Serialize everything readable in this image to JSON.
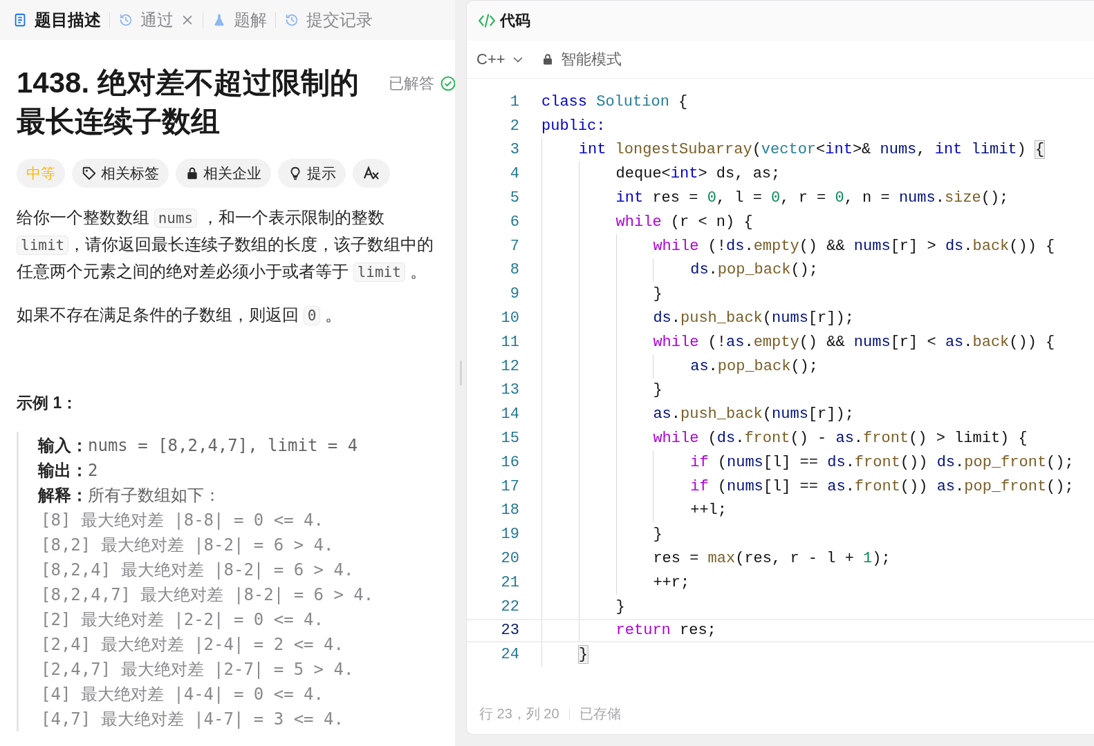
{
  "left_tabs": [
    {
      "label": "题目描述",
      "selected": true,
      "closable": false
    },
    {
      "label": "通过",
      "selected": false,
      "closable": true
    },
    {
      "label": "题解",
      "selected": false,
      "closable": false
    },
    {
      "label": "提交记录",
      "selected": false,
      "closable": false
    }
  ],
  "problem": {
    "title": "1438. 绝对差不超过限制的最长连续子数组",
    "status": "已解答",
    "tags": [
      {
        "kind": "difficulty",
        "label": "中等"
      },
      {
        "kind": "topics",
        "label": "相关标签"
      },
      {
        "kind": "companies",
        "label": "相关企业"
      },
      {
        "kind": "hint",
        "label": "提示"
      },
      {
        "kind": "translate"
      }
    ],
    "paragraphs": [
      [
        {
          "text": "给你一个整数数组 "
        },
        {
          "code": "nums"
        },
        {
          "text": " ，和一个表示限制的整数 "
        },
        {
          "code": "limit"
        },
        {
          "text": "，请你返回最长连续子数组的长度，该子数组中的任意两个元素之间的绝对差必须小于或者等于 "
        },
        {
          "code": "limit"
        },
        {
          "text": " 。"
        }
      ],
      [
        {
          "text": "如果不存在满足条件的子数组，则返回 "
        },
        {
          "code": "0"
        },
        {
          "text": " 。"
        }
      ]
    ],
    "example": {
      "heading": "示例 1：",
      "lines": [
        {
          "label": "输入：",
          "value": "nums = [8,2,4,7], limit = 4"
        },
        {
          "label": "输出：",
          "value": "2"
        },
        {
          "label": "解释：",
          "value": "所有子数组如下："
        },
        {
          "value": "[8] 最大绝对差 |8-8| = 0 <= 4."
        },
        {
          "value": "[8,2] 最大绝对差 |8-2| = 6 > 4."
        },
        {
          "value": "[8,2,4] 最大绝对差 |8-2| = 6 > 4."
        },
        {
          "value": "[8,2,4,7] 最大绝对差 |8-2| = 6 > 4."
        },
        {
          "value": "[2] 最大绝对差 |2-2| = 0 <= 4."
        },
        {
          "value": "[2,4] 最大绝对差 |2-4| = 2 <= 4."
        },
        {
          "value": "[2,4,7] 最大绝对差 |2-7| = 5 > 4."
        },
        {
          "value": "[4] 最大绝对差 |4-4| = 0 <= 4."
        },
        {
          "value": "[4,7] 最大绝对差 |4-7| = 3 <= 4."
        }
      ]
    }
  },
  "editor": {
    "title": "代码",
    "language": "C++",
    "mode": "智能模式",
    "lines": [
      {
        "number": "1",
        "current": false,
        "tokens": [
          {
            "kind": "keyword",
            "text": "class "
          },
          {
            "kind": "type",
            "text": "Solution"
          },
          {
            "kind": "plain",
            "text": " {"
          }
        ]
      },
      {
        "number": "2",
        "current": false,
        "tokens": [
          {
            "kind": "keyword",
            "text": "public:"
          }
        ]
      },
      {
        "number": "3",
        "current": false,
        "tokens": [
          {
            "kind": "indent"
          },
          {
            "kind": "keyword",
            "text": "int "
          },
          {
            "kind": "function",
            "text": "longestSubarray"
          },
          {
            "kind": "plain",
            "text": "("
          },
          {
            "kind": "type",
            "text": "vector"
          },
          {
            "kind": "plain",
            "text": "<"
          },
          {
            "kind": "keyword",
            "text": "int"
          },
          {
            "kind": "plain",
            "text": ">& "
          },
          {
            "kind": "variable",
            "text": "nums"
          },
          {
            "kind": "plain",
            "text": ", "
          },
          {
            "kind": "keyword",
            "text": "int "
          },
          {
            "kind": "variable",
            "text": "limit"
          },
          {
            "kind": "plain",
            "text": ") "
          },
          {
            "kind": "brace_match",
            "text": "{"
          }
        ]
      },
      {
        "number": "4",
        "current": false,
        "tokens": [
          {
            "kind": "indent"
          },
          {
            "kind": "indent"
          },
          {
            "kind": "plain",
            "text": "deque<"
          },
          {
            "kind": "keyword",
            "text": "int"
          },
          {
            "kind": "plain",
            "text": "> ds, as;"
          }
        ]
      },
      {
        "number": "5",
        "current": false,
        "tokens": [
          {
            "kind": "indent"
          },
          {
            "kind": "indent"
          },
          {
            "kind": "keyword",
            "text": "int "
          },
          {
            "kind": "plain",
            "text": "res = "
          },
          {
            "kind": "number",
            "text": "0"
          },
          {
            "kind": "plain",
            "text": ", l = "
          },
          {
            "kind": "number",
            "text": "0"
          },
          {
            "kind": "plain",
            "text": ", r = "
          },
          {
            "kind": "number",
            "text": "0"
          },
          {
            "kind": "plain",
            "text": ", n = "
          },
          {
            "kind": "variable",
            "text": "nums"
          },
          {
            "kind": "plain",
            "text": "."
          },
          {
            "kind": "function",
            "text": "size"
          },
          {
            "kind": "plain",
            "text": "();"
          }
        ]
      },
      {
        "number": "6",
        "current": false,
        "tokens": [
          {
            "kind": "indent"
          },
          {
            "kind": "indent"
          },
          {
            "kind": "control",
            "text": "while "
          },
          {
            "kind": "plain",
            "text": "(r < n) {"
          }
        ]
      },
      {
        "number": "7",
        "current": false,
        "tokens": [
          {
            "kind": "indent"
          },
          {
            "kind": "indent"
          },
          {
            "kind": "indent"
          },
          {
            "kind": "control",
            "text": "while "
          },
          {
            "kind": "plain",
            "text": "(!"
          },
          {
            "kind": "variable",
            "text": "ds"
          },
          {
            "kind": "plain",
            "text": "."
          },
          {
            "kind": "function",
            "text": "empty"
          },
          {
            "kind": "plain",
            "text": "() && "
          },
          {
            "kind": "variable",
            "text": "nums"
          },
          {
            "kind": "plain",
            "text": "[r] > "
          },
          {
            "kind": "variable",
            "text": "ds"
          },
          {
            "kind": "plain",
            "text": "."
          },
          {
            "kind": "function",
            "text": "back"
          },
          {
            "kind": "plain",
            "text": "()) {"
          }
        ]
      },
      {
        "number": "8",
        "current": false,
        "tokens": [
          {
            "kind": "indent"
          },
          {
            "kind": "indent"
          },
          {
            "kind": "indent"
          },
          {
            "kind": "indent"
          },
          {
            "kind": "variable",
            "text": "ds"
          },
          {
            "kind": "plain",
            "text": "."
          },
          {
            "kind": "function",
            "text": "pop_back"
          },
          {
            "kind": "plain",
            "text": "();"
          }
        ]
      },
      {
        "number": "9",
        "current": false,
        "tokens": [
          {
            "kind": "indent"
          },
          {
            "kind": "indent"
          },
          {
            "kind": "indent"
          },
          {
            "kind": "plain",
            "text": "}"
          }
        ]
      },
      {
        "number": "10",
        "current": false,
        "tokens": [
          {
            "kind": "indent"
          },
          {
            "kind": "indent"
          },
          {
            "kind": "indent"
          },
          {
            "kind": "variable",
            "text": "ds"
          },
          {
            "kind": "plain",
            "text": "."
          },
          {
            "kind": "function",
            "text": "push_back"
          },
          {
            "kind": "plain",
            "text": "("
          },
          {
            "kind": "variable",
            "text": "nums"
          },
          {
            "kind": "plain",
            "text": "[r]);"
          }
        ]
      },
      {
        "number": "11",
        "current": false,
        "tokens": [
          {
            "kind": "indent"
          },
          {
            "kind": "indent"
          },
          {
            "kind": "indent"
          },
          {
            "kind": "control",
            "text": "while "
          },
          {
            "kind": "plain",
            "text": "(!"
          },
          {
            "kind": "variable",
            "text": "as"
          },
          {
            "kind": "plain",
            "text": "."
          },
          {
            "kind": "function",
            "text": "empty"
          },
          {
            "kind": "plain",
            "text": "() && "
          },
          {
            "kind": "variable",
            "text": "nums"
          },
          {
            "kind": "plain",
            "text": "[r] < "
          },
          {
            "kind": "variable",
            "text": "as"
          },
          {
            "kind": "plain",
            "text": "."
          },
          {
            "kind": "function",
            "text": "back"
          },
          {
            "kind": "plain",
            "text": "()) {"
          }
        ]
      },
      {
        "number": "12",
        "current": false,
        "tokens": [
          {
            "kind": "indent"
          },
          {
            "kind": "indent"
          },
          {
            "kind": "indent"
          },
          {
            "kind": "indent"
          },
          {
            "kind": "variable",
            "text": "as"
          },
          {
            "kind": "plain",
            "text": "."
          },
          {
            "kind": "function",
            "text": "pop_back"
          },
          {
            "kind": "plain",
            "text": "();"
          }
        ]
      },
      {
        "number": "13",
        "current": false,
        "tokens": [
          {
            "kind": "indent"
          },
          {
            "kind": "indent"
          },
          {
            "kind": "indent"
          },
          {
            "kind": "plain",
            "text": "}"
          }
        ]
      },
      {
        "number": "14",
        "current": false,
        "tokens": [
          {
            "kind": "indent"
          },
          {
            "kind": "indent"
          },
          {
            "kind": "indent"
          },
          {
            "kind": "variable",
            "text": "as"
          },
          {
            "kind": "plain",
            "text": "."
          },
          {
            "kind": "function",
            "text": "push_back"
          },
          {
            "kind": "plain",
            "text": "("
          },
          {
            "kind": "variable",
            "text": "nums"
          },
          {
            "kind": "plain",
            "text": "[r]);"
          }
        ]
      },
      {
        "number": "15",
        "current": false,
        "tokens": [
          {
            "kind": "indent"
          },
          {
            "kind": "indent"
          },
          {
            "kind": "indent"
          },
          {
            "kind": "control",
            "text": "while "
          },
          {
            "kind": "plain",
            "text": "("
          },
          {
            "kind": "variable",
            "text": "ds"
          },
          {
            "kind": "plain",
            "text": "."
          },
          {
            "kind": "function",
            "text": "front"
          },
          {
            "kind": "plain",
            "text": "() - "
          },
          {
            "kind": "variable",
            "text": "as"
          },
          {
            "kind": "plain",
            "text": "."
          },
          {
            "kind": "function",
            "text": "front"
          },
          {
            "kind": "plain",
            "text": "() > limit) {"
          }
        ]
      },
      {
        "number": "16",
        "current": false,
        "tokens": [
          {
            "kind": "indent"
          },
          {
            "kind": "indent"
          },
          {
            "kind": "indent"
          },
          {
            "kind": "indent"
          },
          {
            "kind": "control",
            "text": "if "
          },
          {
            "kind": "plain",
            "text": "("
          },
          {
            "kind": "variable",
            "text": "nums"
          },
          {
            "kind": "plain",
            "text": "[l] == "
          },
          {
            "kind": "variable",
            "text": "ds"
          },
          {
            "kind": "plain",
            "text": "."
          },
          {
            "kind": "function",
            "text": "front"
          },
          {
            "kind": "plain",
            "text": "()) "
          },
          {
            "kind": "variable",
            "text": "ds"
          },
          {
            "kind": "plain",
            "text": "."
          },
          {
            "kind": "function",
            "text": "pop_front"
          },
          {
            "kind": "plain",
            "text": "();"
          }
        ]
      },
      {
        "number": "17",
        "current": false,
        "tokens": [
          {
            "kind": "indent"
          },
          {
            "kind": "indent"
          },
          {
            "kind": "indent"
          },
          {
            "kind": "indent"
          },
          {
            "kind": "control",
            "text": "if "
          },
          {
            "kind": "plain",
            "text": "("
          },
          {
            "kind": "variable",
            "text": "nums"
          },
          {
            "kind": "plain",
            "text": "[l] == "
          },
          {
            "kind": "variable",
            "text": "as"
          },
          {
            "kind": "plain",
            "text": "."
          },
          {
            "kind": "function",
            "text": "front"
          },
          {
            "kind": "plain",
            "text": "()) "
          },
          {
            "kind": "variable",
            "text": "as"
          },
          {
            "kind": "plain",
            "text": "."
          },
          {
            "kind": "function",
            "text": "pop_front"
          },
          {
            "kind": "plain",
            "text": "();"
          }
        ]
      },
      {
        "number": "18",
        "current": false,
        "tokens": [
          {
            "kind": "indent"
          },
          {
            "kind": "indent"
          },
          {
            "kind": "indent"
          },
          {
            "kind": "indent"
          },
          {
            "kind": "plain",
            "text": "++l;"
          }
        ]
      },
      {
        "number": "19",
        "current": false,
        "tokens": [
          {
            "kind": "indent"
          },
          {
            "kind": "indent"
          },
          {
            "kind": "indent"
          },
          {
            "kind": "plain",
            "text": "}"
          }
        ]
      },
      {
        "number": "20",
        "current": false,
        "tokens": [
          {
            "kind": "indent"
          },
          {
            "kind": "indent"
          },
          {
            "kind": "indent"
          },
          {
            "kind": "plain",
            "text": "res = "
          },
          {
            "kind": "function",
            "text": "max"
          },
          {
            "kind": "plain",
            "text": "(res, r - l + "
          },
          {
            "kind": "number",
            "text": "1"
          },
          {
            "kind": "plain",
            "text": ");"
          }
        ]
      },
      {
        "number": "21",
        "current": false,
        "tokens": [
          {
            "kind": "indent"
          },
          {
            "kind": "indent"
          },
          {
            "kind": "indent"
          },
          {
            "kind": "plain",
            "text": "++r;"
          }
        ]
      },
      {
        "number": "22",
        "current": false,
        "tokens": [
          {
            "kind": "indent"
          },
          {
            "kind": "indent"
          },
          {
            "kind": "plain",
            "text": "}"
          }
        ]
      },
      {
        "number": "23",
        "current": true,
        "tokens": [
          {
            "kind": "indent"
          },
          {
            "kind": "indent"
          },
          {
            "kind": "control",
            "text": "return "
          },
          {
            "kind": "plain",
            "text": "res;"
          }
        ]
      },
      {
        "number": "24",
        "current": false,
        "tokens": [
          {
            "kind": "indent"
          },
          {
            "kind": "brace_match",
            "text": "}"
          }
        ]
      }
    ],
    "status": {
      "position": "行 23，列 20",
      "saved": "已存储"
    }
  }
}
